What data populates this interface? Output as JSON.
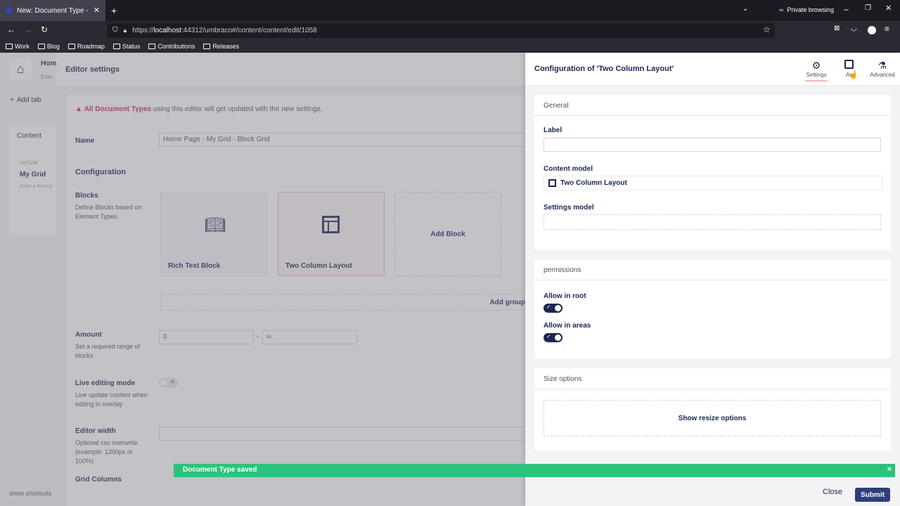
{
  "browser": {
    "tab_title": "New: Document Type - Edit: Ho",
    "private_label": "Private browsing",
    "url_prefix": "https://",
    "url_host": "localhost",
    "url_rest": ":44312/umbraco#/content/content/edit/1058",
    "bookmarks": [
      "Work",
      "Blog",
      "Roadmap",
      "Status",
      "Contributions",
      "Releases"
    ]
  },
  "bg": {
    "home_label": "Hom",
    "home_sub": "Ente",
    "add_tab": "Add tab",
    "content_group": "Content",
    "mygrid_alias": "myGrid",
    "mygrid_name": "My Grid",
    "mygrid_desc": "Enter a descrip",
    "show_shortcuts": "show shortcuts"
  },
  "editor": {
    "title": "Editor settings",
    "warning_strong": "All Document Types",
    "warning_rest": "using this editor will get updated with the new settings.",
    "name_label": "Name",
    "name_value": "Home Page - My Grid - Block Grid",
    "configuration": "Configuration",
    "blocks_label": "Blocks",
    "blocks_desc": "Define Blocks based on Element Types.",
    "block_rich_text": "Rich Text Block",
    "block_two_column": "Two Column Layout",
    "add_block": "Add Block",
    "add_group": "Add group",
    "amount_label": "Amount",
    "amount_desc": "Set a required range of blocks",
    "amount_min": "0",
    "amount_sep": "-",
    "amount_max": "∞",
    "live_label": "Live editing mode",
    "live_desc": "Live update content when editing in overlay",
    "width_label": "Editor width",
    "width_desc": "Optional css overwrite. (example: 1200px or 100%)",
    "grid_columns": "Grid Columns"
  },
  "panel": {
    "title": "Configuration of 'Two Column Layout'",
    "tabs": [
      {
        "label": "Settings",
        "icon": "gear-icon"
      },
      {
        "label": "Areas",
        "icon": "layout-icon"
      },
      {
        "label": "Advanced",
        "icon": "flask-icon"
      }
    ],
    "tab_areas_visible": "Ar",
    "general": "General",
    "label_label": "Label",
    "label_value": "",
    "content_model_label": "Content model",
    "content_model_value": "Two Column Layout",
    "settings_model_label": "Settings model",
    "permissions": "permissions",
    "allow_root": "Allow in root",
    "allow_areas": "Allow in areas",
    "size_options": "Size options",
    "show_resize": "Show resize options",
    "close": "Close",
    "submit": "Submit"
  },
  "toast": {
    "message": "Document Type saved",
    "close_icon": "×"
  }
}
